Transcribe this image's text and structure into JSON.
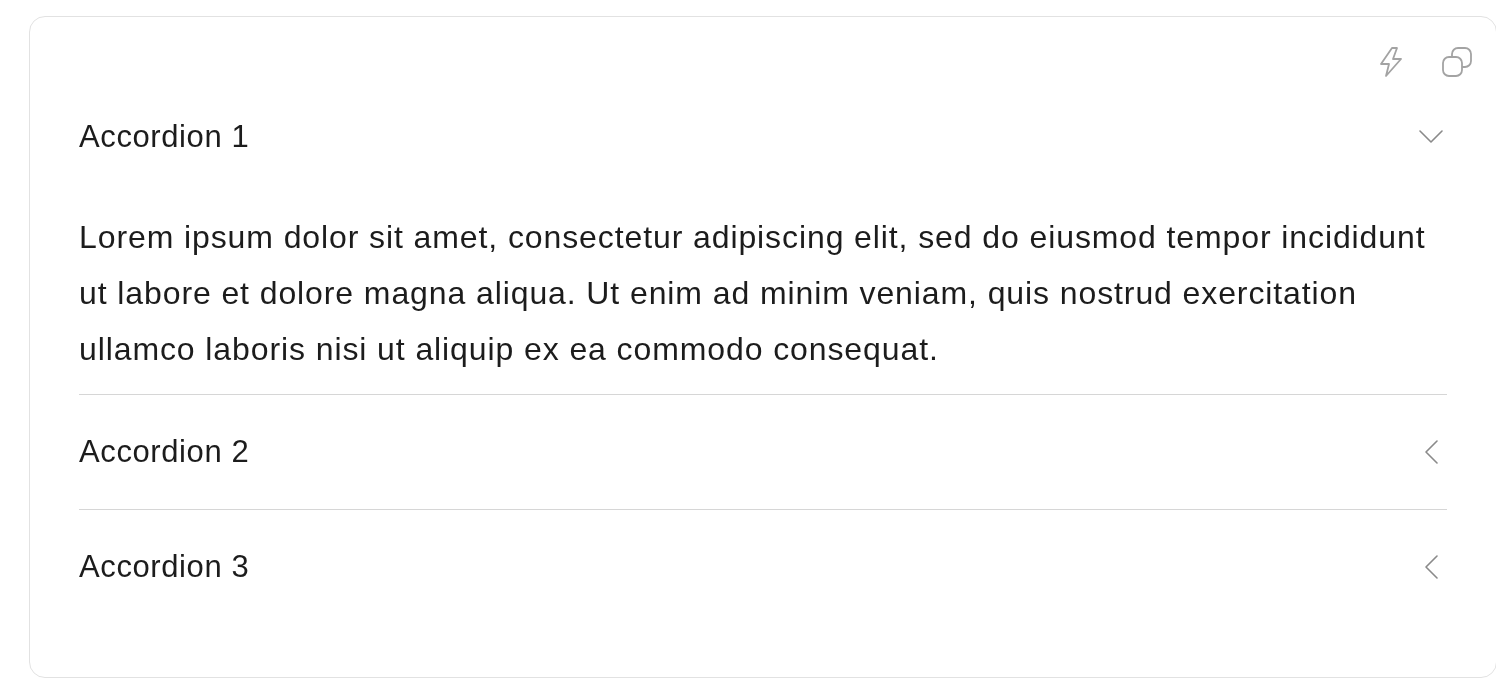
{
  "accordion": {
    "items": [
      {
        "title": "Accordion 1",
        "expanded": true,
        "content": "Lorem ipsum dolor sit amet, consectetur adipiscing elit, sed do eiusmod tempor incididunt ut labore et dolore magna aliqua. Ut enim ad minim veniam, quis nostrud exercitation ullamco laboris nisi ut aliquip ex ea commodo consequat."
      },
      {
        "title": "Accordion 2",
        "expanded": false
      },
      {
        "title": "Accordion 3",
        "expanded": false
      }
    ]
  }
}
